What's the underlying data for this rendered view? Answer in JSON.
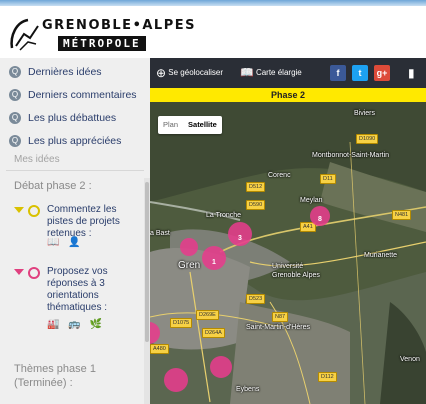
{
  "header": {
    "logo_top": "GRENOBLE•ALPES",
    "logo_bottom": "MÉTROPOLE"
  },
  "sidebar": {
    "items": [
      {
        "label": "Dernières idées",
        "icon": "q-icon"
      },
      {
        "label": "Derniers commentaires",
        "icon": "q-icon"
      },
      {
        "label": "Les plus débattues",
        "icon": "q-icon"
      },
      {
        "label": "Les plus appréciées",
        "icon": "q-icon"
      }
    ],
    "mes_idees": "Mes idées",
    "debat_title": "Débat phase 2 :",
    "topics": [
      {
        "text": "Commentez les pistes de projets retenues :",
        "icons": "📖 👤",
        "color": "#d9c100"
      },
      {
        "text": "Proposez vos réponses à 3 orientations thématiques :",
        "icons": "🏭 🚌 🌿",
        "color": "#e0407f"
      }
    ],
    "themes": "Thèmes phase 1 (Terminée) :"
  },
  "toolbar": {
    "geolocate": "Se géolocaliser",
    "map_label": "Carte élargie",
    "social": [
      {
        "glyph": "f",
        "color": "#3b5998",
        "name": "facebook-icon"
      },
      {
        "glyph": "t",
        "color": "#1da1f2",
        "name": "twitter-icon"
      },
      {
        "glyph": "g+",
        "color": "#dd4b39",
        "name": "googleplus-icon"
      }
    ]
  },
  "phase_label": "Phase 2",
  "map": {
    "plan_label": "Plan",
    "satellite_label": "Satellite",
    "places": [
      {
        "text": "Biviers"
      },
      {
        "text": "Montbonnot-Saint-Martin"
      },
      {
        "text": "Corenc"
      },
      {
        "text": "La Tronche"
      },
      {
        "text": "Meylan"
      },
      {
        "text": "Murianette"
      },
      {
        "text": "Université Grenoble Alpes"
      },
      {
        "text": "Saint-Martin-d'Hères"
      },
      {
        "text": "Gren"
      },
      {
        "text": "a Bast"
      },
      {
        "text": "Eybens"
      },
      {
        "text": "Venon"
      }
    ],
    "roads": [
      {
        "text": "D590"
      },
      {
        "text": "D1090"
      },
      {
        "text": "D11"
      },
      {
        "text": "D512"
      },
      {
        "text": "A41"
      },
      {
        "text": "A480"
      },
      {
        "text": "N87"
      },
      {
        "text": "D523"
      },
      {
        "text": "D1075"
      },
      {
        "text": "D264A"
      },
      {
        "text": "D269E"
      },
      {
        "text": "N481"
      },
      {
        "text": "D112"
      }
    ],
    "markers": [
      {
        "label": "8"
      },
      {
        "label": "1"
      },
      {
        "label": "3"
      },
      {
        "label": ""
      },
      {
        "label": ""
      },
      {
        "label": ""
      },
      {
        "label": ""
      }
    ]
  }
}
